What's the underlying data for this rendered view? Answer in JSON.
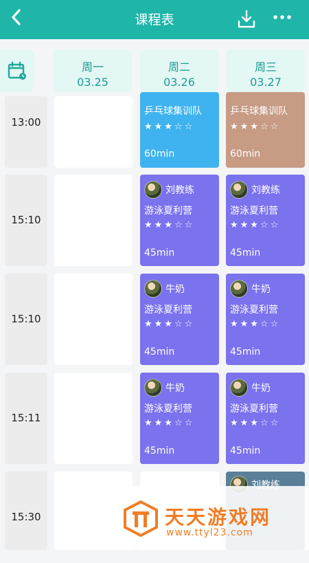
{
  "header": {
    "title": "课程表",
    "back_icon": "chevron-left-icon",
    "download_icon": "download-icon",
    "more_icon": "more-dots-icon",
    "color": "#1fb5a9"
  },
  "days": [
    {
      "name": "周一",
      "date": "03.25"
    },
    {
      "name": "周二",
      "date": "03.26"
    },
    {
      "name": "周三",
      "date": "03.27"
    }
  ],
  "rows": [
    {
      "time": "13:00"
    },
    {
      "time": "15:10"
    },
    {
      "time": "15:10"
    },
    {
      "time": "15:11"
    },
    {
      "time": "15:30"
    }
  ],
  "cards": {
    "r0_tue": {
      "course": "乒乓球集训队",
      "stars": "★★★☆☆",
      "duration": "60min",
      "color": "#3fb3ef"
    },
    "r0_wed": {
      "course": "乒乓球集训队",
      "stars": "★★★☆☆",
      "duration": "60min",
      "color": "#c79b84"
    },
    "r1_tue": {
      "coach": "刘教练",
      "course": "游泳夏利营",
      "stars": "★★★☆☆",
      "duration": "45min",
      "color": "#7b72ee"
    },
    "r1_wed": {
      "coach": "刘教练",
      "course": "游泳夏利营",
      "stars": "★★★☆☆",
      "duration": "45min",
      "color": "#7b72ee"
    },
    "r2_tue": {
      "coach": "牛奶",
      "course": "游泳夏利营",
      "stars": "★★★☆☆",
      "duration": "45min",
      "color": "#7b72ee"
    },
    "r2_wed": {
      "coach": "牛奶",
      "course": "游泳夏利营",
      "stars": "★★★☆☆",
      "duration": "45min",
      "color": "#7b72ee"
    },
    "r3_tue": {
      "coach": "牛奶",
      "course": "游泳夏利营",
      "stars": "★★★☆☆",
      "duration": "45min",
      "color": "#7b72ee"
    },
    "r3_wed": {
      "coach": "牛奶",
      "course": "游泳夏利营",
      "stars": "★★★☆☆",
      "duration": "45min",
      "color": "#7b72ee"
    },
    "r4_wed": {
      "coach": "刘教练",
      "color": "#5a7f98"
    }
  },
  "watermark": {
    "title": "天天游戏网",
    "url": "www.ttyl23.com",
    "color": "#f07d26"
  }
}
